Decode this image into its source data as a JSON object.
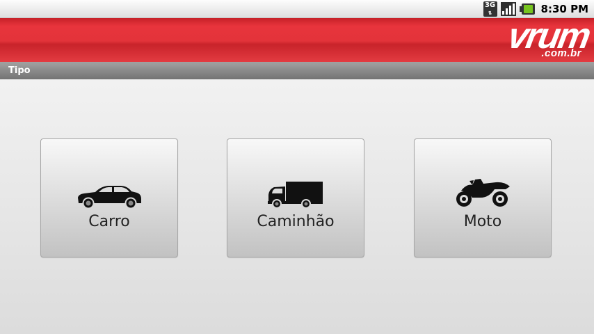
{
  "status_bar": {
    "network_type": "3G",
    "time": "8:30 PM",
    "icons": [
      "network-3g-icon",
      "signal-strength-icon",
      "battery-icon"
    ]
  },
  "header": {
    "logo_word": "vrum",
    "logo_domain": ".com.br",
    "brand_color": "#e3333a"
  },
  "title_bar": {
    "title": "Tipo"
  },
  "vehicle_types": [
    {
      "label": "Carro",
      "icon": "car-icon"
    },
    {
      "label": "Caminhão",
      "icon": "truck-icon"
    },
    {
      "label": "Moto",
      "icon": "motorcycle-icon"
    }
  ]
}
